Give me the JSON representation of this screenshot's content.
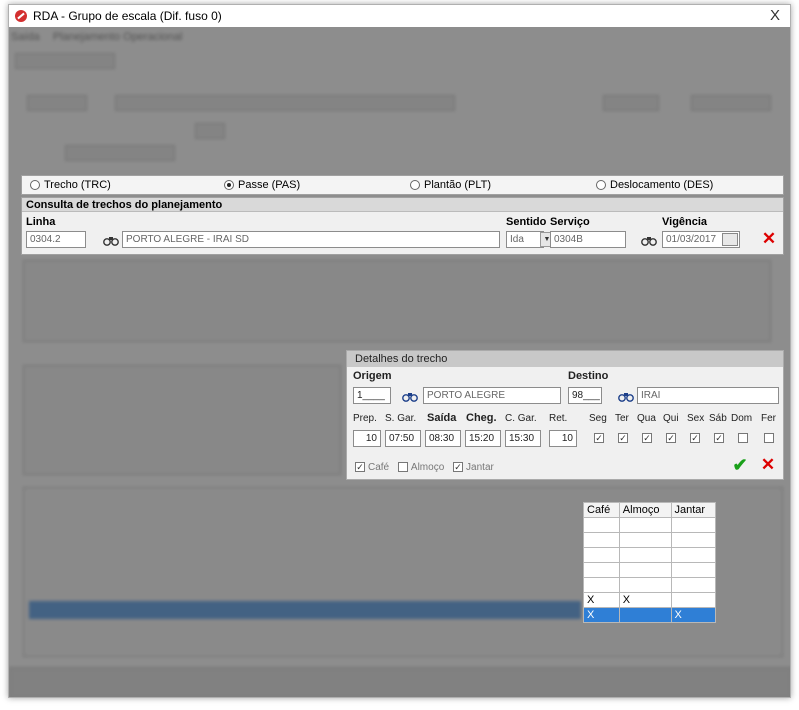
{
  "window": {
    "title": "RDA - Grupo de escala (Dif. fuso 0)",
    "close_label": "X"
  },
  "menu": {
    "items": [
      "Saída",
      "Planejamento Operacional"
    ]
  },
  "types": {
    "options": [
      {
        "label": "Trecho (TRC)",
        "checked": false
      },
      {
        "label": "Passe (PAS)",
        "checked": true
      },
      {
        "label": "Plantão (PLT)",
        "checked": false
      },
      {
        "label": "Deslocamento (DES)",
        "checked": false
      }
    ]
  },
  "consulta": {
    "title": "Consulta de trechos do planejamento",
    "linha_label": "Linha",
    "linha_code": "0304.2",
    "linha_name": "PORTO ALEGRE - IRAI SD",
    "sentido_label": "Sentido",
    "sentido_value": "Ida",
    "servico_label": "Serviço",
    "servico_value": "0304B",
    "vigencia_label": "Vigência",
    "vigencia_value": "01/03/2017"
  },
  "details": {
    "title": "Detalhes do trecho",
    "origem_label": "Origem",
    "origem_code": "1____",
    "origem_name": "PORTO ALEGRE",
    "destino_label": "Destino",
    "destino_code": "98___",
    "destino_name": "IRAI",
    "col_labels": {
      "prep": "Prep.",
      "sgar": "S. Gar.",
      "saida": "Saída",
      "cheg": "Cheg.",
      "cgar": "C. Gar.",
      "ret": "Ret."
    },
    "values": {
      "prep": "10",
      "sgar": "07:50",
      "saida": "08:30",
      "cheg": "15:20",
      "cgar": "15:30",
      "ret": "10"
    },
    "days": [
      {
        "label": "Seg",
        "checked": true
      },
      {
        "label": "Ter",
        "checked": true
      },
      {
        "label": "Qua",
        "checked": true
      },
      {
        "label": "Qui",
        "checked": true
      },
      {
        "label": "Sex",
        "checked": true
      },
      {
        "label": "Sáb",
        "checked": true
      },
      {
        "label": "Dom",
        "checked": false
      },
      {
        "label": "Fer",
        "checked": false
      }
    ],
    "meals": [
      {
        "label": "Café",
        "checked": true
      },
      {
        "label": "Almoço",
        "checked": false
      },
      {
        "label": "Jantar",
        "checked": true
      }
    ],
    "confirm_icon": "check-icon",
    "cancel_icon": "close-icon"
  },
  "meal_grid": {
    "headers": [
      "Café",
      "Almoço",
      "Jantar"
    ],
    "rows": [
      [
        "",
        "",
        ""
      ],
      [
        "",
        "",
        ""
      ],
      [
        "",
        "",
        ""
      ],
      [
        "",
        "",
        ""
      ],
      [
        "",
        "",
        ""
      ],
      [
        "X",
        "X",
        ""
      ],
      [
        "X",
        "",
        "X"
      ]
    ],
    "selected_row": 6
  },
  "colors": {
    "accent_selection": "#2f7fd6",
    "cancel_red": "#dd0000",
    "confirm_green": "#1aa01a"
  }
}
